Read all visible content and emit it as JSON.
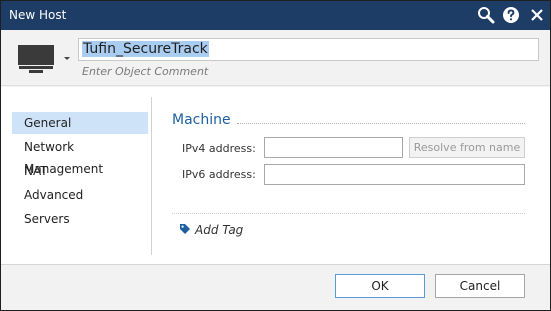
{
  "window": {
    "title": "New Host",
    "icons": [
      "search-icon",
      "help-icon",
      "close-icon"
    ],
    "title_bar_color": "#1d3d66"
  },
  "header": {
    "object_icon": "host-monitor-icon",
    "object_name": "Tufin_SecureTrack",
    "comment_placeholder": "Enter Object Comment"
  },
  "sidebar": {
    "items": [
      {
        "label": "General",
        "selected": true
      },
      {
        "label": "Network Management",
        "selected": false
      },
      {
        "label": "NAT",
        "selected": false
      },
      {
        "label": "Advanced",
        "selected": false
      },
      {
        "label": "Servers",
        "selected": false
      }
    ]
  },
  "machine": {
    "section_title": "Machine",
    "ipv4_label": "IPv4 address:",
    "ipv4_value": "",
    "ipv6_label": "IPv6 address:",
    "ipv6_value": "",
    "resolve_label": "Resolve from name"
  },
  "tags": {
    "add_tag_label": "Add Tag",
    "icon": "tag-icon"
  },
  "footer": {
    "ok_label": "OK",
    "cancel_label": "Cancel"
  },
  "colors": {
    "accent": "#1f5fa0",
    "selection": "#cfe3f8",
    "text_selection": "#a9cdf0"
  }
}
